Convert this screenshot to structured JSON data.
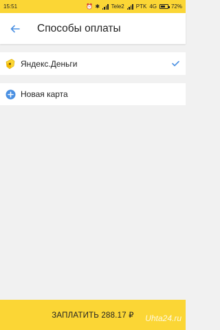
{
  "status_bar": {
    "time": "15:51",
    "carrier1": "Tele2",
    "carrier2": "PTK",
    "network": "4G",
    "battery": "72%",
    "battery_level": 0.72
  },
  "header": {
    "title": "Способы оплаты"
  },
  "payment_methods": [
    {
      "label": "Яндекс.Деньги",
      "icon": "yandex-money-icon",
      "selected": true
    },
    {
      "label": "Новая карта",
      "icon": "add-circle-icon",
      "selected": false
    }
  ],
  "pay_button": {
    "label": "ЗАПЛАТИТЬ 288.17 ₽"
  },
  "watermark": "Uhta24.ru",
  "colors": {
    "accent_yellow": "#fbd635",
    "blue": "#4a90e2",
    "background": "#f1f1f1"
  }
}
